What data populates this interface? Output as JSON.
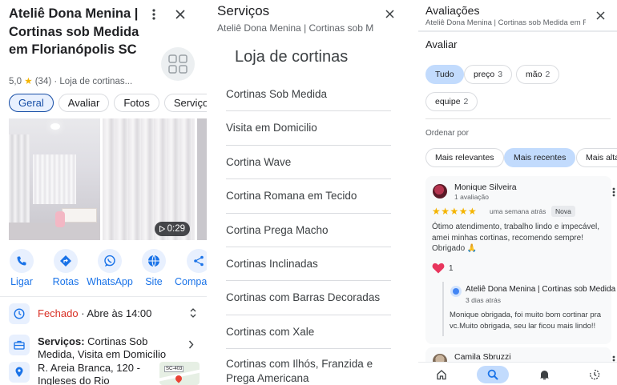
{
  "place": {
    "title": "Ateliê Dona Menina | Cortinas sob Medida em Florianópolis SC",
    "rating": "5,0",
    "star": "★",
    "reviews_count": "(34)",
    "category": "Loja de cortinas..."
  },
  "tabs": [
    "Geral",
    "Avaliar",
    "Fotos",
    "Serviços"
  ],
  "video_duration": "0:29",
  "actions": [
    {
      "label": "Ligar",
      "icon": "phone-icon"
    },
    {
      "label": "Rotas",
      "icon": "directions-icon"
    },
    {
      "label": "WhatsApp",
      "icon": "whatsapp-icon"
    },
    {
      "label": "Site",
      "icon": "globe-icon"
    },
    {
      "label": "Compartilhar",
      "icon": "share-icon"
    }
  ],
  "hours": {
    "status": "Fechado",
    "next": " · Abre às 14:00"
  },
  "services_row": {
    "label": "Serviços:",
    "value": " Cortinas Sob Medida, Visita em Domicílio"
  },
  "address": {
    "line1": "R. Areia Branca, 120 -",
    "line2": "Ingleses do Rio",
    "map_tag": "SC-403"
  },
  "services_panel": {
    "title": "Serviços",
    "subtitle": "Ateliê Dona Menina | Cortinas sob Medida",
    "category": "Loja de cortinas",
    "items": [
      "Cortinas Sob Medida",
      "Visita em Domicilio",
      "Cortina Wave",
      "Cortina Romana em Tecido",
      "Cortina Prega Macho",
      "Cortinas Inclinadas",
      "Cortinas com Barras Decoradas",
      "Cortinas com Xale",
      "Cortinas com Ilhós, Franzida e Prega Americana"
    ]
  },
  "reviews_panel": {
    "title": "Avaliações",
    "subtitle": "Ateliê Dona Menina | Cortinas sob Medida em Floria",
    "section": "Avaliar",
    "filters": [
      {
        "label": "Tudo",
        "count": ""
      },
      {
        "label": "preço",
        "count": "3"
      },
      {
        "label": "mão",
        "count": "2"
      },
      {
        "label": "equipe",
        "count": "2"
      }
    ],
    "order_label": "Ordenar por",
    "sort_options": [
      "Mais relevantes",
      "Mais recentes",
      "Mais altas"
    ],
    "review1": {
      "name": "Monique Silveira",
      "count": "1 avaliação",
      "stars": "★★★★★",
      "when": "uma semana atrás",
      "badge": "Nova",
      "text": "Ótimo atendimento, trabalho lindo e impecável, amei minhas cortinas, recomendo sempre! Obrigado 🙏",
      "likes": "1"
    },
    "reply": {
      "name": "Ateliê Dona Menina | Cortinas sob Medida",
      "when": "3 dias atrás",
      "text": "Monique obrigada, foi muito bom cortinar pra vc.Muito obrigada, seu lar ficou mais lindo!!"
    },
    "review2": {
      "name": "Camila Sbruzzi"
    }
  },
  "colors": {
    "accent": "#1a73e8",
    "closed": "#d93025",
    "star": "#f4b400",
    "chip_selected": "#c2dbfd"
  }
}
